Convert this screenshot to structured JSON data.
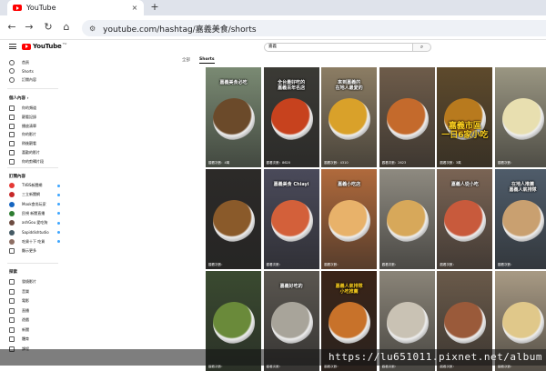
{
  "browser": {
    "tab_title": "YouTube",
    "tab_close": "×",
    "new_tab": "+",
    "back": "←",
    "forward": "→",
    "reload": "↻",
    "home": "⌂",
    "url": "youtube.com/hashtag/嘉義美食/shorts"
  },
  "header": {
    "logo_text": "YouTube",
    "logo_region": "TW",
    "search_value": "嘉義",
    "search_icon": "search-icon"
  },
  "sidebar": {
    "main": [
      {
        "label": "首頁"
      },
      {
        "label": "Shorts"
      },
      {
        "label": "訂閱內容"
      }
    ],
    "you_heading": "個人內容 ›",
    "you": [
      {
        "label": "你的頻道"
      },
      {
        "label": "觀看記錄"
      },
      {
        "label": "播放清單"
      },
      {
        "label": "你的影片"
      },
      {
        "label": "稍後觀看"
      },
      {
        "label": "喜歡的影片"
      },
      {
        "label": "你的剪輯片段"
      }
    ],
    "subs_heading": "訂閱內容",
    "subs": [
      {
        "label": "TVBS新聞網",
        "dot": true
      },
      {
        "label": "三立新聞網",
        "dot": true
      },
      {
        "label": "Mook食尚玩家",
        "dot": true
      },
      {
        "label": "民視 新聞直播",
        "dot": true
      },
      {
        "label": "ashGou 愛吃狗",
        "dot": true
      },
      {
        "label": "Sapiddishtudio",
        "dot": true
      },
      {
        "label": "吃貨十下 吃貨",
        "dot": true
      },
      {
        "label": "顯示更多",
        "dot": false
      }
    ],
    "explore_heading": "探索",
    "explore": [
      {
        "label": "發燒影片"
      },
      {
        "label": "音樂"
      },
      {
        "label": "電影"
      },
      {
        "label": "直播"
      },
      {
        "label": "遊戲"
      },
      {
        "label": "新聞"
      },
      {
        "label": "體育"
      },
      {
        "label": "課程"
      }
    ]
  },
  "filters": {
    "all": "全部",
    "shorts": "Shorts"
  },
  "shorts": [
    {
      "views": "觀看次數：4萬",
      "overlay": "嘉義美食必吃",
      "overlay_color": "#ffffff",
      "bg": "#7a8a73",
      "food": "#6b4a2a"
    },
    {
      "views": "觀看次數：8620",
      "overlay": "全台最好吃的\n嘉義百年名店",
      "overlay_color": "#ffffff",
      "bg": "#3b3a35",
      "food": "#c7421e"
    },
    {
      "views": "觀看次數：4310",
      "overlay": "來到嘉義的\n在地人最愛的",
      "overlay_color": "#ffffff",
      "bg": "#8c7d64",
      "food": "#d9a12a"
    },
    {
      "views": "觀看次數：2623",
      "overlay": "",
      "overlay_color": "#ffffff",
      "bg": "#6e5c4a",
      "food": "#c46a2c"
    },
    {
      "views": "觀看次數：3萬",
      "overlay": "嘉義市區\n一日6家小吃",
      "overlay_color": "#ffd21f",
      "bg": "#5e4a2c",
      "food": "#b87a1e"
    },
    {
      "views": "觀看次數：",
      "overlay": "",
      "overlay_color": "#ffffff",
      "bg": "#9a9682",
      "food": "#e8dfb0"
    },
    {
      "views": "觀看次數：",
      "overlay": "",
      "overlay_color": "#ffffff",
      "bg": "#2c2a28",
      "food": "#8a5a2a"
    },
    {
      "views": "觀看次數：",
      "overlay": "嘉義美食 Chiayi",
      "overlay_color": "#ffffff",
      "bg": "#4a4a5a",
      "food": "#d3603a"
    },
    {
      "views": "觀看次數：",
      "overlay": "嘉義小吃店",
      "overlay_color": "#ffffff",
      "bg": "#b06a3c",
      "food": "#e8b26a"
    },
    {
      "views": "觀看次數：",
      "overlay": "",
      "overlay_color": "#ffffff",
      "bg": "#8e8a80",
      "food": "#d7a85a"
    },
    {
      "views": "觀看次數：",
      "overlay": "嘉義人從小吃",
      "overlay_color": "#ffffff",
      "bg": "#7a6454",
      "food": "#c85a3c"
    },
    {
      "views": "觀看次數：",
      "overlay": "在地人推薦\n嘉義人氣排隊",
      "overlay_color": "#ffffff",
      "bg": "#4f5c6a",
      "food": "#c9a070"
    },
    {
      "views": "觀看次數：",
      "overlay": "",
      "overlay_color": "#ffffff",
      "bg": "#3a4a30",
      "food": "#6a8a3a"
    },
    {
      "views": "觀看次數：",
      "overlay": "嘉義好吃的",
      "overlay_color": "#ffffff",
      "bg": "#5a5650",
      "food": "#a8a49a"
    },
    {
      "views": "觀看次數：",
      "overlay": "嘉義人氣排隊\n小吃推薦",
      "overlay_color": "#ffd21f",
      "bg": "#3a2418",
      "food": "#c8722a"
    },
    {
      "views": "觀看次數：",
      "overlay": "",
      "overlay_color": "#ffffff",
      "bg": "#8a8478",
      "food": "#c9c2b4"
    },
    {
      "views": "觀看次數：",
      "overlay": "",
      "overlay_color": "#ffffff",
      "bg": "#6a5a4a",
      "food": "#9a5a3a"
    },
    {
      "views": "觀看次數：",
      "overlay": "",
      "overlay_color": "#ffffff",
      "bg": "#a89a84",
      "food": "#e0c88a"
    }
  ],
  "watermark": "https://lu651011.pixnet.net/album"
}
